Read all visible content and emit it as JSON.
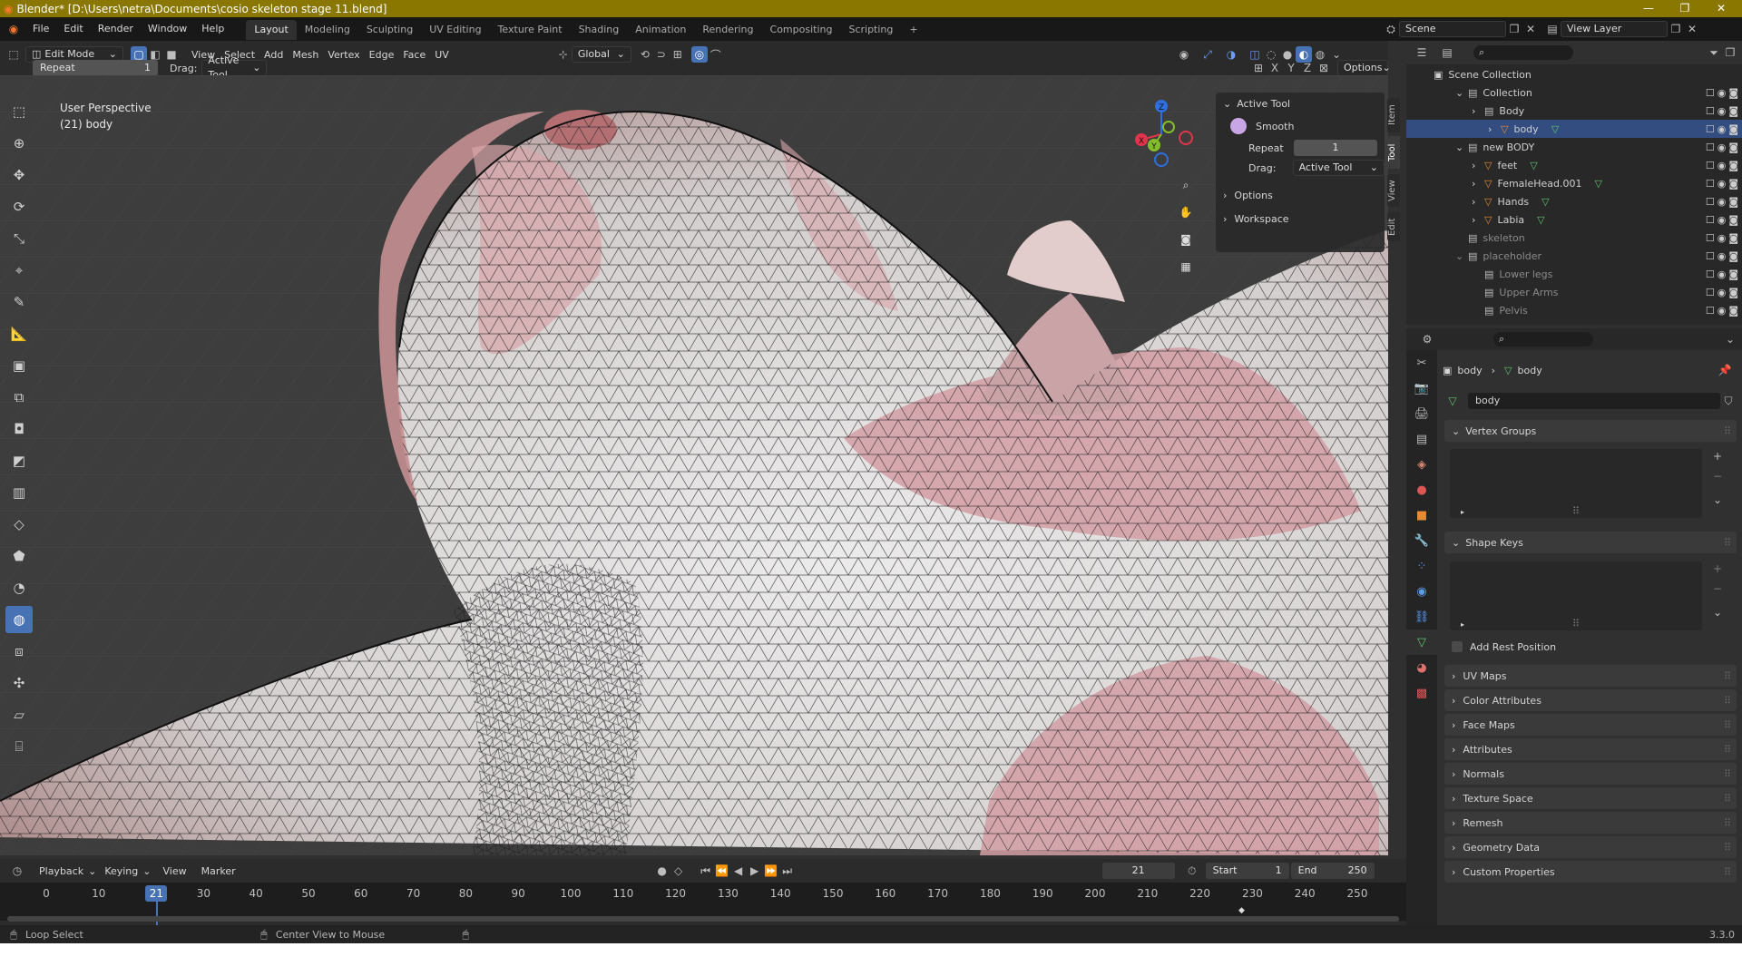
{
  "window": {
    "title": "Blender* [D:\\Users\\netra\\Documents\\cosio skeleton stage 11.blend]",
    "controls": [
      "—",
      "❐",
      "✕"
    ]
  },
  "menubar": {
    "items": [
      "File",
      "Edit",
      "Render",
      "Window",
      "Help"
    ],
    "workspaces": [
      "Layout",
      "Modeling",
      "Sculpting",
      "UV Editing",
      "Texture Paint",
      "Shading",
      "Animation",
      "Rendering",
      "Compositing",
      "Scripting"
    ],
    "active_workspace": "Layout",
    "add_tab": "+",
    "scene": "Scene",
    "view_layer": "View Layer"
  },
  "viewport_header": {
    "mode": "Edit Mode",
    "menus": [
      "View",
      "Select",
      "Add",
      "Mesh",
      "Vertex",
      "Edge",
      "Face",
      "UV"
    ],
    "orientation": "Global",
    "axes": [
      "X",
      "Y",
      "Z"
    ],
    "options": "Options"
  },
  "tool_settings": {
    "repeat_label": "Repeat",
    "repeat_value": "1",
    "drag_label": "Drag:",
    "drag_value": "Active Tool"
  },
  "viewport": {
    "perspective": "User Perspective",
    "object": "(21) body",
    "gizmo": {
      "x": "X",
      "y": "Y",
      "z": "Z"
    }
  },
  "npanel": {
    "section": "Active Tool",
    "tool_name": "Smooth",
    "repeat_label": "Repeat",
    "repeat_value": "1",
    "drag_label": "Drag:",
    "drag_value": "Active Tool",
    "options": "Options",
    "workspace": "Workspace",
    "tabs": [
      "Item",
      "Tool",
      "View",
      "Edit"
    ]
  },
  "outliner": {
    "root": "Scene Collection",
    "rows": [
      {
        "label": "Collection",
        "depth": 1,
        "dim": false
      },
      {
        "label": "Body",
        "depth": 2,
        "dim": false
      },
      {
        "label": "body",
        "depth": 3,
        "dim": false,
        "selected": true
      },
      {
        "label": "new BODY",
        "depth": 1,
        "dim": false
      },
      {
        "label": "feet",
        "depth": 2,
        "dim": false
      },
      {
        "label": "FemaleHead.001",
        "depth": 2,
        "dim": false
      },
      {
        "label": "Hands",
        "depth": 2,
        "dim": false
      },
      {
        "label": "Labia",
        "depth": 2,
        "dim": false
      },
      {
        "label": "skeleton",
        "depth": 1,
        "dim": true
      },
      {
        "label": "placeholder",
        "depth": 1,
        "dim": true
      },
      {
        "label": "Lower legs",
        "depth": 2,
        "dim": true
      },
      {
        "label": "Upper Arms",
        "depth": 2,
        "dim": true
      },
      {
        "label": "Pelvis",
        "depth": 2,
        "dim": true
      }
    ]
  },
  "properties": {
    "breadcrumb_object": "body",
    "breadcrumb_data": "body",
    "datablock": "body",
    "vertex_groups": "Vertex Groups",
    "shape_keys": "Shape Keys",
    "add_rest_position": "Add Rest Position",
    "sections": [
      "UV Maps",
      "Color Attributes",
      "Face Maps",
      "Attributes",
      "Normals",
      "Texture Space",
      "Remesh",
      "Geometry Data",
      "Custom Properties"
    ]
  },
  "timeline": {
    "menus": [
      "Playback",
      "Keying",
      "View",
      "Marker"
    ],
    "current_frame": "21",
    "start_label": "Start",
    "start": "1",
    "end_label": "End",
    "end": "250",
    "ticks": [
      "0",
      "10",
      "21",
      "30",
      "40",
      "50",
      "60",
      "70",
      "80",
      "90",
      "100",
      "110",
      "120",
      "130",
      "140",
      "150",
      "160",
      "170",
      "180",
      "190",
      "200",
      "210",
      "220",
      "230",
      "240",
      "250"
    ]
  },
  "statusbar": {
    "left": "Loop Select",
    "middle": "Center View to Mouse",
    "version": "3.3.0"
  },
  "colors": {
    "title_bar": "#8a7700",
    "accent": "#4772b3",
    "selected_row": "#334d80",
    "mesh_skin": "#e6dcdc",
    "mesh_pink": "#d29ea4"
  }
}
